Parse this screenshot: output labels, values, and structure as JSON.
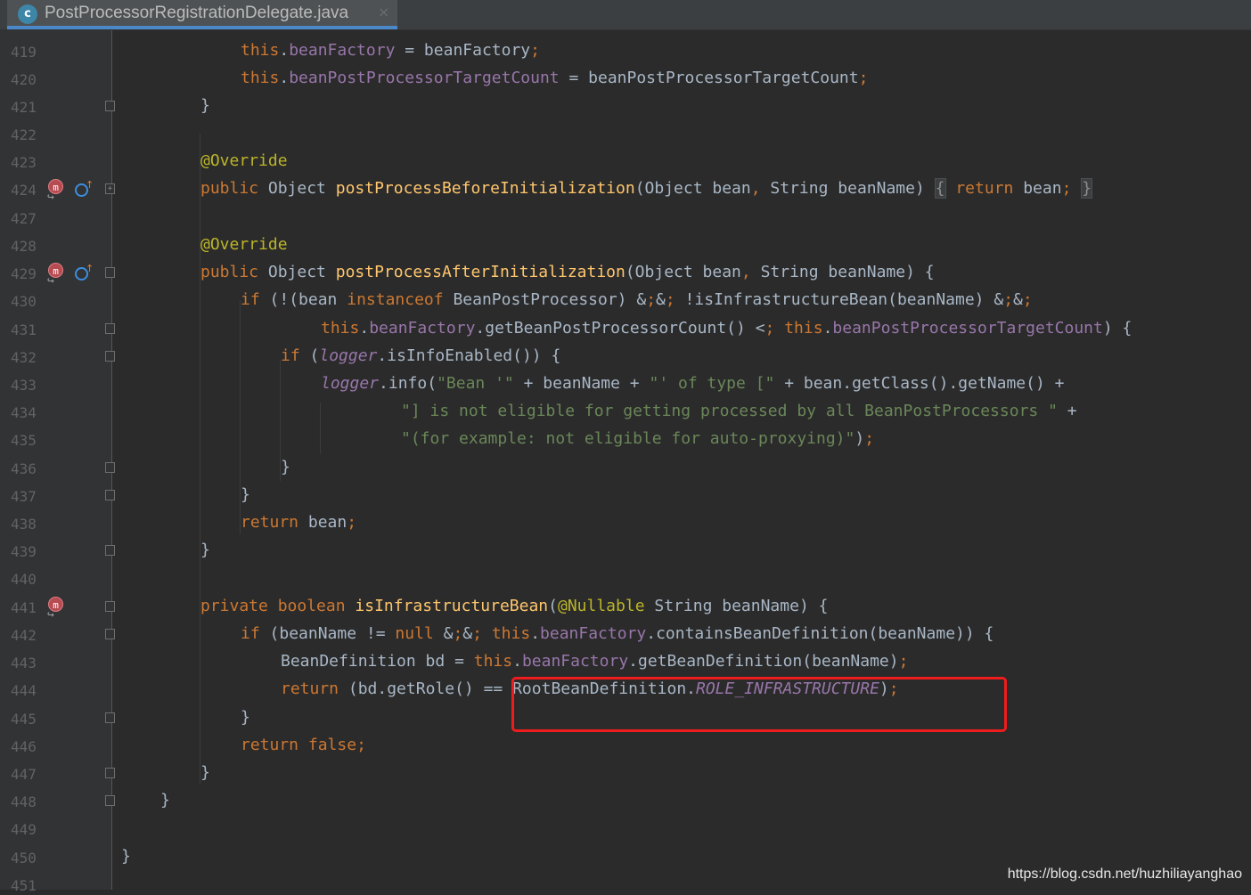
{
  "editor": {
    "tab": {
      "icon": "java-class-icon",
      "icon_glyph": "c",
      "title": "PostProcessorRegistrationDelegate.java",
      "close": "×"
    },
    "lines": [
      {
        "num": "419",
        "code": "this.beanFactory = beanFactory;"
      },
      {
        "num": "420",
        "code": "this.beanPostProcessorTargetCount = beanPostProcessorTargetCount;"
      },
      {
        "num": "421",
        "code": "}"
      },
      {
        "num": "422",
        "code": ""
      },
      {
        "num": "423",
        "code": "@Override"
      },
      {
        "num": "424",
        "code": "public Object postProcessBeforeInitialization(Object bean, String beanName) { return bean; }"
      },
      {
        "num": "427",
        "code": ""
      },
      {
        "num": "428",
        "code": "@Override"
      },
      {
        "num": "429",
        "code": "public Object postProcessAfterInitialization(Object bean, String beanName) {"
      },
      {
        "num": "430",
        "code": "if (!(bean instanceof BeanPostProcessor) && !isInfrastructureBean(beanName) &&"
      },
      {
        "num": "431",
        "code": "this.beanFactory.getBeanPostProcessorCount() < this.beanPostProcessorTargetCount) {"
      },
      {
        "num": "432",
        "code": "if (logger.isInfoEnabled()) {"
      },
      {
        "num": "433",
        "code": "logger.info(\"Bean '\" + beanName + \"' of type [\" + bean.getClass().getName() +"
      },
      {
        "num": "434",
        "code": "\"] is not eligible for getting processed by all BeanPostProcessors \" +"
      },
      {
        "num": "435",
        "code": "\"(for example: not eligible for auto-proxying)\");"
      },
      {
        "num": "436",
        "code": "}"
      },
      {
        "num": "437",
        "code": "}"
      },
      {
        "num": "438",
        "code": "return bean;"
      },
      {
        "num": "439",
        "code": "}"
      },
      {
        "num": "440",
        "code": ""
      },
      {
        "num": "441",
        "code": "private boolean isInfrastructureBean(@Nullable String beanName) {"
      },
      {
        "num": "442",
        "code": "if (beanName != null && this.beanFactory.containsBeanDefinition(beanName)) {"
      },
      {
        "num": "443",
        "code": "BeanDefinition bd = this.beanFactory.getBeanDefinition(beanName);"
      },
      {
        "num": "444",
        "code": "return (bd.getRole() == RootBeanDefinition.ROLE_INFRASTRUCTURE);"
      },
      {
        "num": "445",
        "code": "}"
      },
      {
        "num": "446",
        "code": "return false;"
      },
      {
        "num": "447",
        "code": "}"
      },
      {
        "num": "448",
        "code": "}"
      },
      {
        "num": "449",
        "code": ""
      },
      {
        "num": "450",
        "code": "}"
      },
      {
        "num": "451",
        "code": ""
      }
    ],
    "gutter_icons": {
      "override_marker": "m",
      "implements_marker_arrow": "↑",
      "fold_collapsed": "+",
      "fold_open": "−"
    },
    "colors": {
      "background": "#2b2b2b",
      "keyword": "#cc7832",
      "field": "#9876aa",
      "method": "#ffc66d",
      "string": "#6a8759",
      "annotation": "#bbb529",
      "text": "#a9b7c6",
      "highlight_box": "#ee1c1c"
    }
  },
  "watermark": "https://blog.csdn.net/huzhiliayanghao"
}
